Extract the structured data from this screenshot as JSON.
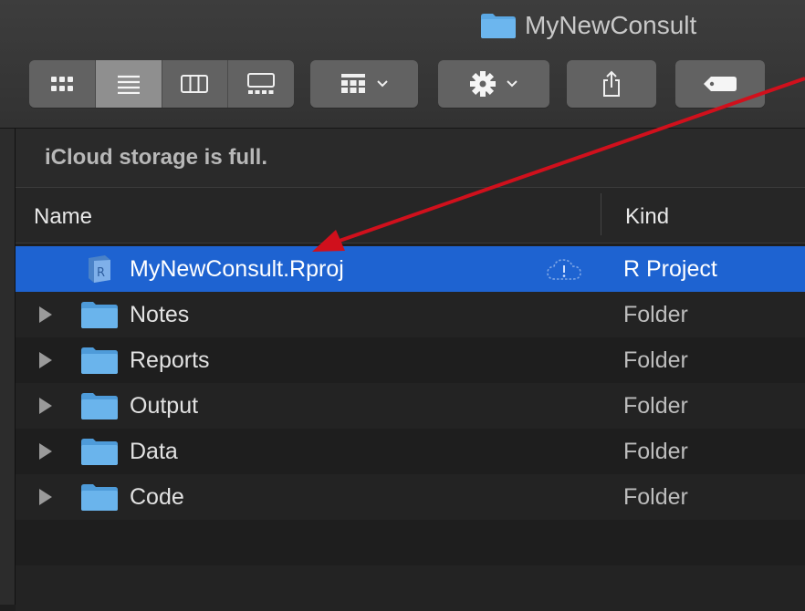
{
  "window": {
    "title": "MyNewConsult",
    "folder_color": "#5ba8e4"
  },
  "toolbar": {
    "view_modes": [
      {
        "icon": "icon-view-icon",
        "active": false
      },
      {
        "icon": "list-view-icon",
        "active": true
      },
      {
        "icon": "column-view-icon",
        "active": false
      },
      {
        "icon": "gallery-view-icon",
        "active": false
      }
    ],
    "group_icon": "group-by-icon",
    "action_icon": "gear-icon",
    "share_icon": "share-icon",
    "tag_icon": "tag-icon"
  },
  "banner": {
    "text": "iCloud storage is full."
  },
  "columns": {
    "name": "Name",
    "kind": "Kind"
  },
  "files": [
    {
      "name": "MyNewConsult.Rproj",
      "kind": "R Project",
      "type": "rproj",
      "selected": true,
      "cloud_warning": true
    },
    {
      "name": "Notes",
      "kind": "Folder",
      "type": "folder",
      "selected": false
    },
    {
      "name": "Reports",
      "kind": "Folder",
      "type": "folder",
      "selected": false
    },
    {
      "name": "Output",
      "kind": "Folder",
      "type": "folder",
      "selected": false
    },
    {
      "name": "Data",
      "kind": "Folder",
      "type": "folder",
      "selected": false
    },
    {
      "name": "Code",
      "kind": "Folder",
      "type": "folder",
      "selected": false
    }
  ],
  "colors": {
    "selection": "#1e63d1",
    "annotation_arrow": "#d0101c"
  }
}
